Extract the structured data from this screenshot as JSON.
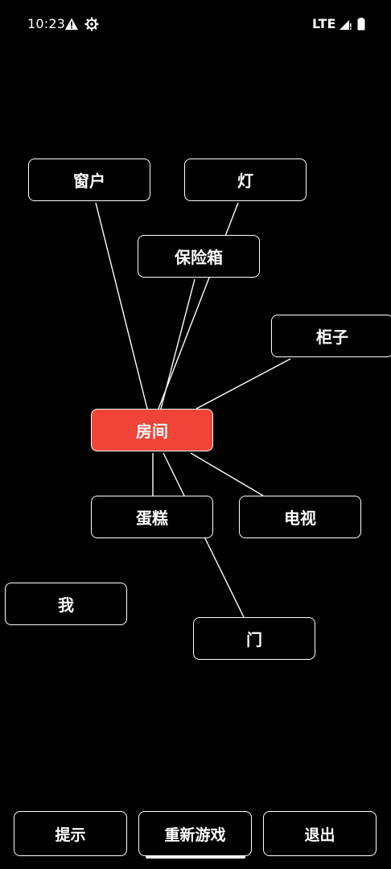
{
  "status_bar": {
    "time": "10:23",
    "network": "LTE",
    "icons": [
      "warning-icon",
      "settings-gear-icon",
      "signal-icon",
      "battery-icon"
    ]
  },
  "graph": {
    "center": "房间",
    "center_color": "#ef4437",
    "nodes": {
      "window": "窗户",
      "lamp": "灯",
      "safe": "保险箱",
      "cabinet": "柜子",
      "cake": "蛋糕",
      "tv": "电视",
      "me": "我",
      "door": "门"
    }
  },
  "buttons": {
    "hint": "提示",
    "restart": "重新游戏",
    "exit": "退出"
  }
}
